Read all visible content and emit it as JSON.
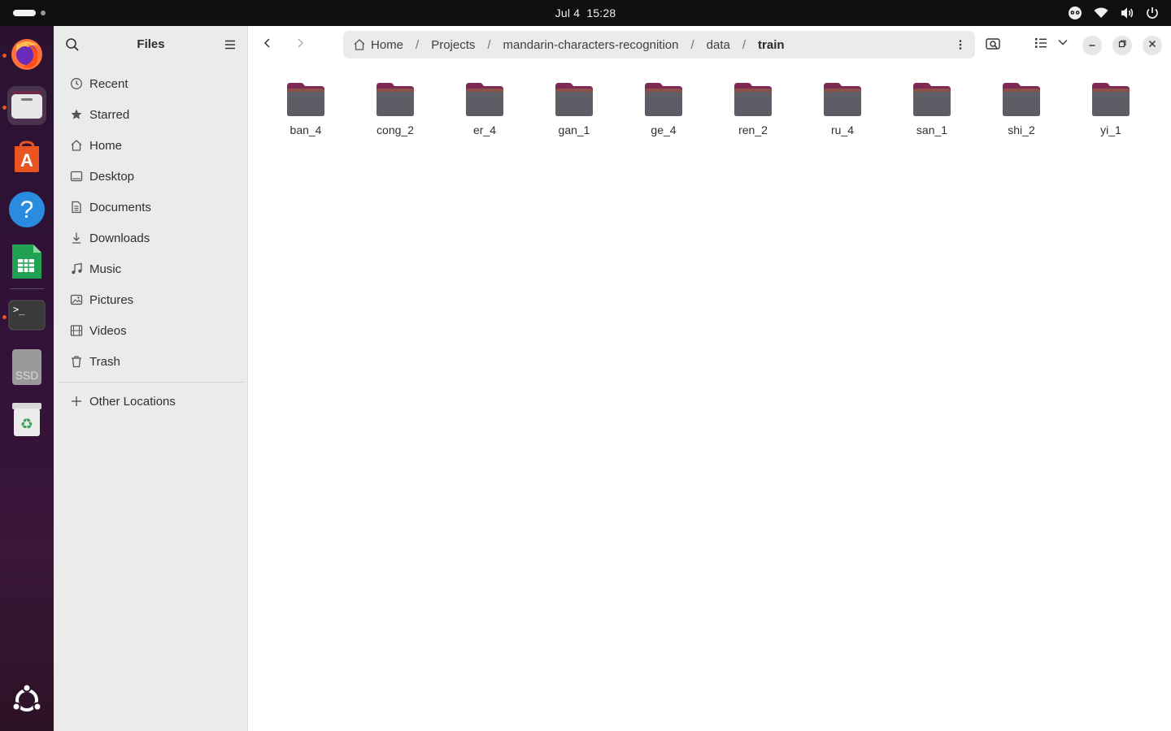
{
  "topbar": {
    "date": "Jul 4",
    "time": "15:28",
    "tray_icons": [
      "accessibility-icon",
      "wifi-icon",
      "volume-icon",
      "power-icon"
    ]
  },
  "dock": {
    "apps": [
      {
        "name": "firefox",
        "icon": "firefox-icon",
        "running": true
      },
      {
        "name": "files",
        "icon": "files-icon",
        "running": true,
        "active": true
      },
      {
        "name": "app-center",
        "icon": "app-center-icon",
        "running": false
      },
      {
        "name": "help",
        "icon": "help-icon",
        "running": false
      },
      {
        "name": "calc",
        "icon": "spreadsheet-icon",
        "running": false
      },
      {
        "name": "terminal",
        "icon": "terminal-icon",
        "running": true
      },
      {
        "name": "ssd",
        "icon": "drive-icon",
        "label": "SSD"
      },
      {
        "name": "trash",
        "icon": "trash-icon",
        "running": false
      },
      {
        "name": "show-apps",
        "icon": "ubuntu-icon"
      }
    ]
  },
  "sidebar": {
    "title": "Files",
    "items": [
      {
        "label": "Recent",
        "icon": "clock-icon"
      },
      {
        "label": "Starred",
        "icon": "star-icon"
      },
      {
        "label": "Home",
        "icon": "home-icon"
      },
      {
        "label": "Desktop",
        "icon": "desktop-icon"
      },
      {
        "label": "Documents",
        "icon": "document-icon"
      },
      {
        "label": "Downloads",
        "icon": "download-icon"
      },
      {
        "label": "Music",
        "icon": "music-icon"
      },
      {
        "label": "Pictures",
        "icon": "picture-icon"
      },
      {
        "label": "Videos",
        "icon": "video-icon"
      },
      {
        "label": "Trash",
        "icon": "trash-icon"
      }
    ],
    "other_locations": "Other Locations"
  },
  "pathbar": {
    "crumbs": [
      "Home",
      "Projects",
      "mandarin-characters-recognition",
      "data",
      "train"
    ],
    "separator": "/"
  },
  "folders": [
    "ban_4",
    "cong_2",
    "er_4",
    "gan_1",
    "ge_4",
    "ren_2",
    "ru_4",
    "san_1",
    "shi_2",
    "yi_1"
  ],
  "colors": {
    "accent": "#e95420",
    "folder_body": "#5e5c64",
    "folder_tab": "#7f2a55"
  }
}
